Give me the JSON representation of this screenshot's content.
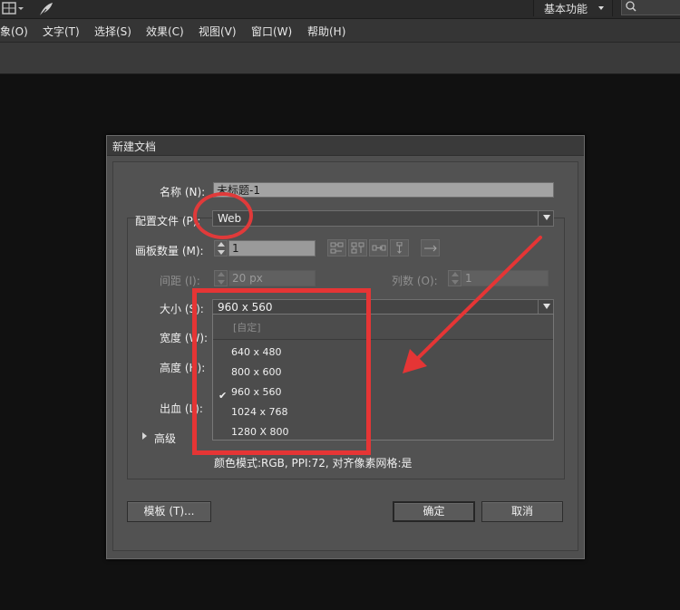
{
  "menubar": {
    "items": [
      "象(O)",
      "文字(T)",
      "选择(S)",
      "效果(C)",
      "视图(V)",
      "窗口(W)",
      "帮助(H)"
    ]
  },
  "workspace": {
    "label": "基本功能"
  },
  "dialog": {
    "title": "新建文档",
    "name_label": "名称 (N):",
    "name_value": "未标题-1",
    "profile_label": "配置文件 (P):",
    "profile_value": "Web",
    "artboards_label": "画板数量 (M):",
    "artboards_value": "1",
    "spacing_label": "间距 (I):",
    "spacing_value": "20 px",
    "columns_label": "列数 (O):",
    "columns_value": "1",
    "size_label": "大小 (S):",
    "size_value": "960 x 560",
    "width_label": "宽度 (W):",
    "height_label": "高度 (H):",
    "bleed_label": "出血 (L):",
    "advanced_label": "高级",
    "info_text": "颜色模式:RGB, PPI:72, 对齐像素网格:是",
    "template_button": "模板 (T)...",
    "ok_button": "确定",
    "cancel_button": "取消"
  },
  "size_dropdown": {
    "custom": "[自定]",
    "options": [
      "640 x 480",
      "800 x 600",
      "960 x 560",
      "1024 x 768",
      "1280 X 800"
    ],
    "selected": "960 x 560",
    "check": "✔"
  },
  "colors": {
    "annotation": "#e53535",
    "dialog_bg": "#4f4f4f",
    "workspace_bg": "#111111"
  }
}
